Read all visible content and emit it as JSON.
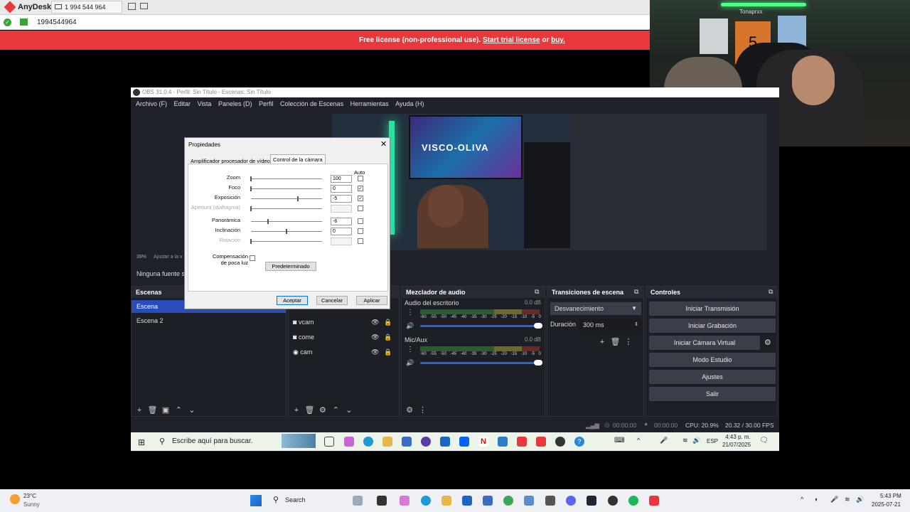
{
  "anydesk": {
    "app": "AnyDesk",
    "tab_id": "1 994 544 964",
    "address": "1994544964",
    "banner_text": "Free license (non-professional use).",
    "banner_link1": "Start trial license",
    "banner_or": "or",
    "banner_link2": "buy."
  },
  "obs": {
    "title": "OBS 31.0.4 - Perfil: Sin Título - Escenas: Sin Título",
    "menu": [
      "Archivo (F)",
      "Editar",
      "Vista",
      "Paneles (D)",
      "Perfil",
      "Colección de Escenas",
      "Herramientas",
      "Ayuda (H)"
    ],
    "preview_status": {
      "percent": "39%",
      "adjust": "Ajustar a la v"
    },
    "no_source": "Ninguna fuente s",
    "scenes": {
      "title": "Escenas",
      "items": [
        "Escena",
        "Escena 2"
      ]
    },
    "sources": {
      "items": [
        "vcam",
        "come",
        "cam"
      ]
    },
    "mixer": {
      "title": "Mezclador de audio",
      "channels": [
        {
          "name": "Audio del escritorio",
          "db": "0.0 dB"
        },
        {
          "name": "Mic/Aux",
          "db": "0.0 dB"
        }
      ],
      "ticks": [
        "-60",
        "-55",
        "-50",
        "-45",
        "-40",
        "-35",
        "-30",
        "-25",
        "-20",
        "-15",
        "-10",
        "-5",
        "0"
      ]
    },
    "transitions": {
      "title": "Transiciones de escena",
      "selected": "Desvanecimiento",
      "duration_label": "Duración",
      "duration_value": "300 ms"
    },
    "controls": {
      "title": "Controles",
      "buttons": [
        "Iniciar Transmisión",
        "Iniciar Grabación",
        "Iniciar Cámara Virtual",
        "Modo Estudio",
        "Ajustes",
        "Salir"
      ]
    },
    "status": {
      "stream_time": "00:00:00",
      "rec_time": "00:00:00",
      "cpu": "CPU: 20.9%",
      "fps": "20.32 / 30.00 FPS"
    }
  },
  "dialog": {
    "title": "Propiedades",
    "tabs": [
      "Amplificador procesador de vídeo",
      "Control de la cámara"
    ],
    "auto_header": "Auto",
    "rows": [
      {
        "label": "Zoom",
        "value": "100",
        "auto": "",
        "enabled": true,
        "level": 0.0
      },
      {
        "label": "Foco",
        "value": "0",
        "auto": "✓",
        "enabled": true,
        "level": 0.0
      },
      {
        "label": "Exposición",
        "value": "-5",
        "auto": "✓",
        "enabled": true,
        "level": 0.66
      },
      {
        "label": "Apertura (diafragma)",
        "value": "",
        "auto": "",
        "enabled": false,
        "level": 0.0
      },
      {
        "label": "Panorámica",
        "value": "-6",
        "auto": "",
        "enabled": true,
        "level": 0.24
      },
      {
        "label": "Inclinación",
        "value": "0",
        "auto": "",
        "enabled": true,
        "level": 0.5
      },
      {
        "label": "Rotación",
        "value": "",
        "auto": "",
        "enabled": false,
        "level": 0.0
      }
    ],
    "lowlight_label": "Compensación de poca luz",
    "default_btn": "Predeterminado",
    "accept": "Aceptar",
    "cancel": "Cancelar",
    "apply": "Aplicar"
  },
  "obs_taskbar": {
    "search": "Escribe aquí para buscar.",
    "lang": "ESP",
    "time": "4:43 p. m.",
    "date": "21/07/2025"
  },
  "win_taskbar": {
    "temp": "23°C",
    "weather": "Sunny",
    "search": "Search",
    "time": "5:43 PM",
    "date": "2025-07-21"
  },
  "preview_sign": "VISCO-OLIVA",
  "webcam_sign": "Tonaprxx"
}
